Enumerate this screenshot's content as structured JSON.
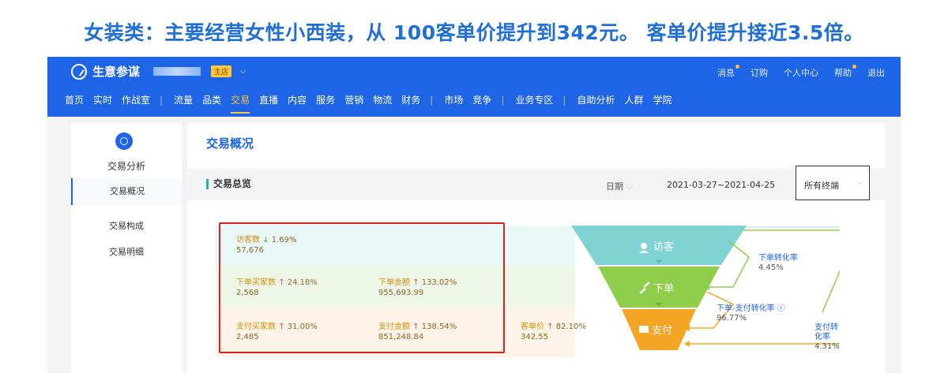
{
  "headline": "女装类：主要经营女性小西装，从 100客单价提升到342元。 客单价提升接近3.5倍。",
  "app": {
    "name": "生意参谋",
    "shop_tag": "主店",
    "top_links": [
      "消息",
      "订购",
      "个人中心",
      "帮助",
      "退出"
    ],
    "nav": [
      "首页",
      "实时",
      "作战室",
      "|",
      "流量",
      "品类",
      "交易",
      "直播",
      "内容",
      "服务",
      "营销",
      "物流",
      "财务",
      "|",
      "市场",
      "竞争",
      "|",
      "业务专区",
      "|",
      "自助分析",
      "人群",
      "学院"
    ],
    "nav_active": "交易"
  },
  "sidebar": {
    "title": "交易分析",
    "items": [
      "交易概况",
      "交易构成",
      "交易明细"
    ]
  },
  "main": {
    "title": "交易概况",
    "section": "交易总览",
    "date_label": "日期",
    "date_range": "2021-03-27~2021-04-25",
    "terminal": "所有终端"
  },
  "metrics": {
    "visitors": {
      "label": "访客数",
      "change": "1.69%",
      "value": "57,676"
    },
    "order_buyers": {
      "label": "下单买家数",
      "change": "24.18%",
      "value": "2,568"
    },
    "order_amount": {
      "label": "下单金额",
      "change": "133.02%",
      "value": "955,693.99"
    },
    "pay_buyers": {
      "label": "支付买家数",
      "change": "31.00%",
      "value": "2,485"
    },
    "pay_amount": {
      "label": "支付金额",
      "change": "138.54%",
      "value": "851,248.84"
    },
    "unit_price": {
      "label": "客单价",
      "change": "82.10%",
      "value": "342.55"
    }
  },
  "funnel": {
    "stages": [
      "访客",
      "下单",
      "支付"
    ],
    "colors": [
      "#7fd3d3",
      "#8fce4a",
      "#f5a524"
    ],
    "order_rate": {
      "label": "下单转化率",
      "value": "4.45%"
    },
    "order_pay_rate": {
      "label": "下单-支付转化率",
      "value": "96.77%"
    },
    "pay_rate": {
      "label": "支付转化率",
      "value": "4.31%"
    }
  }
}
